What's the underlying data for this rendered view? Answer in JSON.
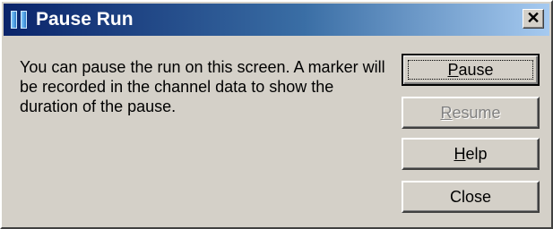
{
  "window": {
    "title": "Pause Run",
    "title_icon": "pause-icon",
    "close_glyph": "✕"
  },
  "message": "You can pause the run on this screen. A marker will be recorded in the channel data to show the duration of the pause.",
  "buttons": {
    "pause": {
      "label_pre": "",
      "mnemonic": "P",
      "label_post": "ause",
      "enabled": true,
      "default": true
    },
    "resume": {
      "label_pre": "",
      "mnemonic": "R",
      "label_post": "esume",
      "enabled": false
    },
    "help": {
      "label_pre": "",
      "mnemonic": "H",
      "label_post": "elp",
      "enabled": true
    },
    "close": {
      "label": "Close",
      "enabled": true
    }
  },
  "colors": {
    "titlebar_start": "#0a246a",
    "titlebar_end": "#a6caf0",
    "face": "#d4d0c8",
    "disabled_text": "#808080"
  }
}
